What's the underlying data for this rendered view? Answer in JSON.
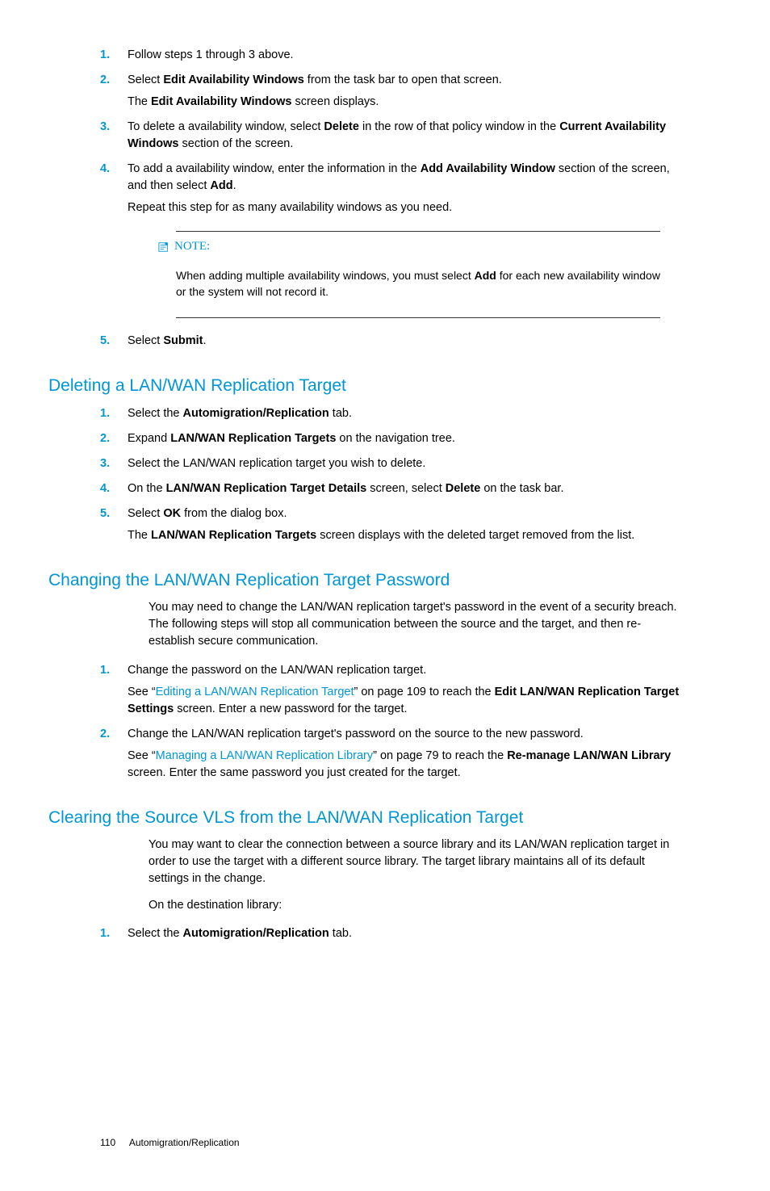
{
  "steps_a": [
    {
      "n": "1.",
      "paras": [
        [
          {
            "t": "Follow steps 1 through 3 above."
          }
        ]
      ]
    },
    {
      "n": "2.",
      "paras": [
        [
          {
            "t": "Select "
          },
          {
            "t": "Edit Availability Windows",
            "b": true
          },
          {
            "t": " from the task bar to open that screen."
          }
        ],
        [
          {
            "t": "The "
          },
          {
            "t": "Edit Availability Windows",
            "b": true
          },
          {
            "t": " screen displays."
          }
        ]
      ]
    },
    {
      "n": "3.",
      "paras": [
        [
          {
            "t": "To delete a availability window, select "
          },
          {
            "t": "Delete",
            "b": true
          },
          {
            "t": " in the row of that policy window in the "
          },
          {
            "t": "Current Availability Windows",
            "b": true
          },
          {
            "t": " section of the screen."
          }
        ]
      ]
    },
    {
      "n": "4.",
      "paras": [
        [
          {
            "t": "To add a availability window, enter the information in the "
          },
          {
            "t": "Add Availability Window",
            "b": true
          },
          {
            "t": " section of the screen, and then select "
          },
          {
            "t": "Add",
            "b": true
          },
          {
            "t": "."
          }
        ],
        [
          {
            "t": "Repeat this step for as many availability windows as you need."
          }
        ]
      ]
    }
  ],
  "note": {
    "label": "NOTE:",
    "paras": [
      [
        {
          "t": "When adding multiple availability windows, you must select "
        },
        {
          "t": "Add",
          "b": true
        },
        {
          "t": " for each new availability window or the system will not record it."
        }
      ]
    ]
  },
  "steps_a2": [
    {
      "n": "5.",
      "paras": [
        [
          {
            "t": "Select "
          },
          {
            "t": "Submit",
            "b": true
          },
          {
            "t": "."
          }
        ]
      ]
    }
  ],
  "h1": "Deleting a LAN/WAN Replication Target",
  "steps_b": [
    {
      "n": "1.",
      "paras": [
        [
          {
            "t": "Select the "
          },
          {
            "t": "Automigration/Replication",
            "b": true
          },
          {
            "t": " tab."
          }
        ]
      ]
    },
    {
      "n": "2.",
      "paras": [
        [
          {
            "t": "Expand "
          },
          {
            "t": "LAN/WAN Replication Targets",
            "b": true
          },
          {
            "t": " on the navigation tree."
          }
        ]
      ]
    },
    {
      "n": "3.",
      "paras": [
        [
          {
            "t": "Select the LAN/WAN replication target you wish to delete."
          }
        ]
      ]
    },
    {
      "n": "4.",
      "paras": [
        [
          {
            "t": "On the "
          },
          {
            "t": "LAN/WAN Replication Target Details",
            "b": true
          },
          {
            "t": " screen, select "
          },
          {
            "t": "Delete",
            "b": true
          },
          {
            "t": " on the task bar."
          }
        ]
      ]
    },
    {
      "n": "5.",
      "paras": [
        [
          {
            "t": "Select "
          },
          {
            "t": "OK",
            "b": true
          },
          {
            "t": " from the dialog box."
          }
        ],
        [
          {
            "t": "The "
          },
          {
            "t": "LAN/WAN Replication Targets",
            "b": true
          },
          {
            "t": " screen displays with the deleted target removed from the list."
          }
        ]
      ]
    }
  ],
  "h2": "Changing the LAN/WAN Replication Target Password",
  "intro2": [
    [
      {
        "t": "You may need to change the LAN/WAN replication target's password in the event of a security breach. The following steps will stop all communication between the source and the target, and then re-establish secure communication."
      }
    ]
  ],
  "steps_c": [
    {
      "n": "1.",
      "paras": [
        [
          {
            "t": "Change the password on the LAN/WAN replication target."
          }
        ],
        [
          {
            "t": "See “"
          },
          {
            "t": "Editing a LAN/WAN Replication Target",
            "link": true
          },
          {
            "t": "” on page 109 to reach the "
          },
          {
            "t": "Edit LAN/WAN Replication Target Settings",
            "b": true
          },
          {
            "t": " screen. Enter a new password for the target."
          }
        ]
      ]
    },
    {
      "n": "2.",
      "paras": [
        [
          {
            "t": "Change the LAN/WAN replication target's password on the source to the new password."
          }
        ],
        [
          {
            "t": "See “"
          },
          {
            "t": "Managing a LAN/WAN Replication Library",
            "link": true
          },
          {
            "t": "” on page 79 to reach the "
          },
          {
            "t": "Re-manage LAN/WAN Library",
            "b": true
          },
          {
            "t": " screen. Enter the same password you just created for the target."
          }
        ]
      ]
    }
  ],
  "h3": "Clearing the Source VLS from the LAN/WAN Replication Target",
  "intro3": [
    [
      {
        "t": "You may want to clear the connection between a source library and its LAN/WAN replication target in order to use the target with a different source library. The target library maintains all of its default settings in the change."
      }
    ],
    [
      {
        "t": "On the destination library:"
      }
    ]
  ],
  "steps_d": [
    {
      "n": "1.",
      "paras": [
        [
          {
            "t": "Select the "
          },
          {
            "t": "Automigration/Replication",
            "b": true
          },
          {
            "t": " tab."
          }
        ]
      ]
    }
  ],
  "footer": {
    "page": "110",
    "title": "Automigration/Replication"
  }
}
